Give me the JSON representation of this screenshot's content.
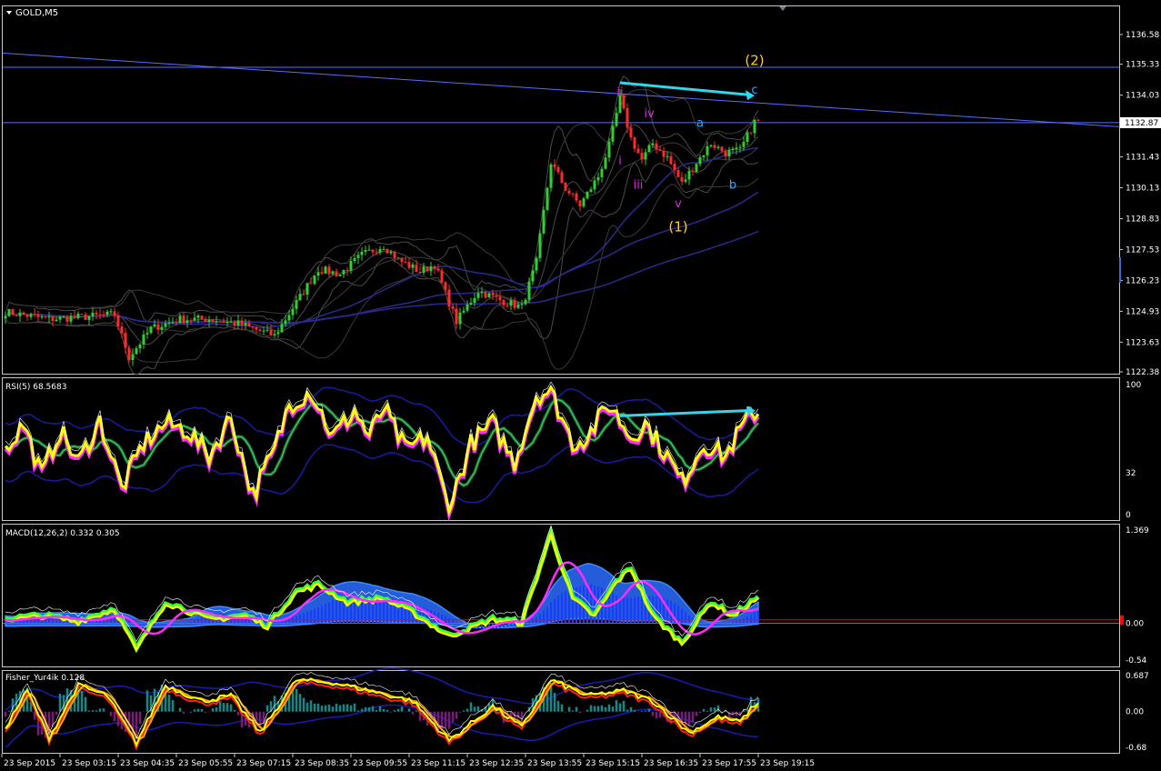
{
  "window": {
    "symbol_label": "GOLD,M5",
    "menu_icon": "triangle-down-icon",
    "corner_icon": "triangle-down-icon"
  },
  "colors": {
    "background": "#000000",
    "frame": "#c8c8c8",
    "text": "#ffffff",
    "bull_candle": "#33cc33",
    "bear_candle": "#ff2a2a",
    "bands": "#4a4a4a",
    "ma_blue": "#2a2a8c",
    "trend_line": "#5a6cff",
    "arrow": "#33d6e8",
    "wave_impulse": "#d62bd6",
    "wave_corrective": "#3aa6ff",
    "wave_degree": "#ffd11a",
    "rsi_main": "#ffff00",
    "rsi_shadow": "#ff2bff",
    "rsi_signal": "#2fcf5a",
    "macd_hist": "#1a3aff",
    "macd_fill": "#2a6cff",
    "macd_main": "#ffff00",
    "macd_signal": "#ff2bff",
    "macd_trend": "#33ff33",
    "zero_line": "#ff0000",
    "fisher_pos": "#128a8a",
    "fisher_neg": "#7a1a7a"
  },
  "chart_data": [
    {
      "type": "candlestick",
      "title": "GOLD,M5",
      "current_price": "1132.87",
      "price_axis_ticks": [
        "1136.58",
        "1135.33",
        "1134.03",
        "1131.43",
        "1130.13",
        "1128.83",
        "1127.53",
        "1126.23",
        "1124.93",
        "1123.63",
        "1122.38"
      ],
      "ylim": [
        1122.38,
        1136.58
      ],
      "grid": false,
      "horizontal_levels": [
        1135.2,
        1132.87
      ],
      "wave_labels": [
        {
          "text": "(2)",
          "group": "degree",
          "bar": 206,
          "price": 1135.3
        },
        {
          "text": "c",
          "group": "corrective",
          "bar": 206,
          "price": 1134.1
        },
        {
          "text": "ii",
          "group": "impulse",
          "bar": 169,
          "price": 1134.0
        },
        {
          "text": "iv",
          "group": "impulse",
          "bar": 177,
          "price": 1133.1
        },
        {
          "text": "a",
          "group": "corrective",
          "bar": 191,
          "price": 1132.7
        },
        {
          "text": "i",
          "group": "impulse",
          "bar": 169,
          "price": 1131.1
        },
        {
          "text": "iii",
          "group": "impulse",
          "bar": 174,
          "price": 1130.1
        },
        {
          "text": "b",
          "group": "corrective",
          "bar": 200,
          "price": 1130.1
        },
        {
          "text": "v",
          "group": "impulse",
          "bar": 185,
          "price": 1129.3
        },
        {
          "text": "(1)",
          "group": "degree",
          "bar": 185,
          "price": 1128.3
        }
      ],
      "annotations": [
        {
          "type": "arrow",
          "from_bar": 169,
          "from_price": 1134.55,
          "to_bar": 204,
          "to_price": 1134.05
        }
      ],
      "key_prices": [
        {
          "bar": 0,
          "price": 1124.9
        },
        {
          "bar": 12,
          "price": 1124.6
        },
        {
          "bar": 22,
          "price": 1124.7
        },
        {
          "bar": 30,
          "price": 1124.8
        },
        {
          "bar": 34,
          "price": 1123.0
        },
        {
          "bar": 40,
          "price": 1124.2
        },
        {
          "bar": 48,
          "price": 1124.6
        },
        {
          "bar": 56,
          "price": 1124.6
        },
        {
          "bar": 64,
          "price": 1124.4
        },
        {
          "bar": 74,
          "price": 1123.9
        },
        {
          "bar": 80,
          "price": 1125.3
        },
        {
          "bar": 86,
          "price": 1126.7
        },
        {
          "bar": 92,
          "price": 1126.5
        },
        {
          "bar": 98,
          "price": 1127.3
        },
        {
          "bar": 104,
          "price": 1127.7
        },
        {
          "bar": 108,
          "price": 1127.1
        },
        {
          "bar": 114,
          "price": 1126.6
        },
        {
          "bar": 118,
          "price": 1126.9
        },
        {
          "bar": 124,
          "price": 1124.5
        },
        {
          "bar": 130,
          "price": 1125.8
        },
        {
          "bar": 136,
          "price": 1125.4
        },
        {
          "bar": 142,
          "price": 1125.1
        },
        {
          "bar": 146,
          "price": 1127.0
        },
        {
          "bar": 150,
          "price": 1131.2
        },
        {
          "bar": 154,
          "price": 1130.1
        },
        {
          "bar": 158,
          "price": 1129.4
        },
        {
          "bar": 163,
          "price": 1130.6
        },
        {
          "bar": 166,
          "price": 1131.9
        },
        {
          "bar": 169,
          "price": 1133.9
        },
        {
          "bar": 172,
          "price": 1132.2
        },
        {
          "bar": 175,
          "price": 1131.3
        },
        {
          "bar": 178,
          "price": 1132.0
        },
        {
          "bar": 182,
          "price": 1131.4
        },
        {
          "bar": 186,
          "price": 1130.3
        },
        {
          "bar": 190,
          "price": 1131.2
        },
        {
          "bar": 194,
          "price": 1132.0
        },
        {
          "bar": 198,
          "price": 1131.6
        },
        {
          "bar": 202,
          "price": 1131.7
        },
        {
          "bar": 206,
          "price": 1132.9
        }
      ]
    },
    {
      "type": "line",
      "title": "RSI(5) 68.5683",
      "axis_ticks": [
        "100",
        "32",
        "0"
      ],
      "ylim": [
        0,
        100
      ],
      "annotations": [
        {
          "type": "arrow",
          "from_bar": 169,
          "to_bar": 204,
          "from_value": 76,
          "to_value": 80
        }
      ],
      "key_values": [
        {
          "bar": 0,
          "value": 50
        },
        {
          "bar": 5,
          "value": 70
        },
        {
          "bar": 10,
          "value": 30
        },
        {
          "bar": 15,
          "value": 65
        },
        {
          "bar": 20,
          "value": 40
        },
        {
          "bar": 26,
          "value": 72
        },
        {
          "bar": 32,
          "value": 20
        },
        {
          "bar": 38,
          "value": 55
        },
        {
          "bar": 44,
          "value": 70
        },
        {
          "bar": 50,
          "value": 65
        },
        {
          "bar": 56,
          "value": 45
        },
        {
          "bar": 62,
          "value": 75
        },
        {
          "bar": 68,
          "value": 15
        },
        {
          "bar": 74,
          "value": 50
        },
        {
          "bar": 78,
          "value": 85
        },
        {
          "bar": 84,
          "value": 95
        },
        {
          "bar": 90,
          "value": 60
        },
        {
          "bar": 96,
          "value": 80
        },
        {
          "bar": 100,
          "value": 60
        },
        {
          "bar": 104,
          "value": 82
        },
        {
          "bar": 110,
          "value": 50
        },
        {
          "bar": 116,
          "value": 60
        },
        {
          "bar": 122,
          "value": 5
        },
        {
          "bar": 128,
          "value": 55
        },
        {
          "bar": 134,
          "value": 70
        },
        {
          "bar": 140,
          "value": 40
        },
        {
          "bar": 146,
          "value": 92
        },
        {
          "bar": 150,
          "value": 95
        },
        {
          "bar": 156,
          "value": 55
        },
        {
          "bar": 160,
          "value": 60
        },
        {
          "bar": 166,
          "value": 85
        },
        {
          "bar": 172,
          "value": 60
        },
        {
          "bar": 176,
          "value": 70
        },
        {
          "bar": 182,
          "value": 45
        },
        {
          "bar": 186,
          "value": 25
        },
        {
          "bar": 192,
          "value": 55
        },
        {
          "bar": 198,
          "value": 45
        },
        {
          "bar": 202,
          "value": 65
        },
        {
          "bar": 206,
          "value": 79
        }
      ]
    },
    {
      "type": "line",
      "title": "MACD(12,26,2) 0.332 0.305",
      "axis_ticks": [
        "1.369",
        "0.00",
        "-0.54"
      ],
      "ylim": [
        -0.54,
        1.369
      ],
      "key_values": [
        {
          "bar": 0,
          "value": 0.05
        },
        {
          "bar": 10,
          "value": 0.1
        },
        {
          "bar": 20,
          "value": 0.02
        },
        {
          "bar": 30,
          "value": 0.2
        },
        {
          "bar": 36,
          "value": -0.4
        },
        {
          "bar": 44,
          "value": 0.3
        },
        {
          "bar": 56,
          "value": 0.05
        },
        {
          "bar": 66,
          "value": 0.1
        },
        {
          "bar": 72,
          "value": -0.05
        },
        {
          "bar": 80,
          "value": 0.45
        },
        {
          "bar": 86,
          "value": 0.55
        },
        {
          "bar": 94,
          "value": 0.3
        },
        {
          "bar": 104,
          "value": 0.35
        },
        {
          "bar": 112,
          "value": 0.15
        },
        {
          "bar": 122,
          "value": -0.2
        },
        {
          "bar": 134,
          "value": 0.05
        },
        {
          "bar": 142,
          "value": 0.0
        },
        {
          "bar": 150,
          "value": 1.3
        },
        {
          "bar": 156,
          "value": 0.35
        },
        {
          "bar": 162,
          "value": 0.1
        },
        {
          "bar": 168,
          "value": 0.6
        },
        {
          "bar": 172,
          "value": 0.8
        },
        {
          "bar": 178,
          "value": 0.1
        },
        {
          "bar": 186,
          "value": -0.3
        },
        {
          "bar": 194,
          "value": 0.3
        },
        {
          "bar": 200,
          "value": 0.1
        },
        {
          "bar": 206,
          "value": 0.33
        }
      ]
    },
    {
      "type": "line",
      "title": "Fisher_Yur4ik 0.128",
      "axis_ticks": [
        "0.687",
        "0.00",
        "-0.68"
      ],
      "ylim": [
        -0.68,
        0.687
      ],
      "key_values": [
        {
          "bar": 0,
          "value": -0.3
        },
        {
          "bar": 6,
          "value": 0.4
        },
        {
          "bar": 12,
          "value": -0.5
        },
        {
          "bar": 20,
          "value": 0.5
        },
        {
          "bar": 28,
          "value": 0.3
        },
        {
          "bar": 36,
          "value": -0.6
        },
        {
          "bar": 44,
          "value": 0.5
        },
        {
          "bar": 54,
          "value": 0.2
        },
        {
          "bar": 62,
          "value": 0.3
        },
        {
          "bar": 70,
          "value": -0.4
        },
        {
          "bar": 80,
          "value": 0.6
        },
        {
          "bar": 90,
          "value": 0.55
        },
        {
          "bar": 100,
          "value": 0.4
        },
        {
          "bar": 112,
          "value": 0.2
        },
        {
          "bar": 122,
          "value": -0.55
        },
        {
          "bar": 134,
          "value": 0.1
        },
        {
          "bar": 142,
          "value": -0.3
        },
        {
          "bar": 150,
          "value": 0.6
        },
        {
          "bar": 160,
          "value": 0.3
        },
        {
          "bar": 170,
          "value": 0.4
        },
        {
          "bar": 178,
          "value": 0.2
        },
        {
          "bar": 188,
          "value": -0.4
        },
        {
          "bar": 196,
          "value": -0.1
        },
        {
          "bar": 202,
          "value": -0.2
        },
        {
          "bar": 206,
          "value": 0.13
        }
      ]
    }
  ],
  "time_axis": {
    "labels": [
      "23 Sep 2015",
      "23 Sep 03:15",
      "23 Sep 04:35",
      "23 Sep 05:55",
      "23 Sep 07:15",
      "23 Sep 08:35",
      "23 Sep 09:55",
      "23 Sep 11:15",
      "23 Sep 12:35",
      "23 Sep 13:55",
      "23 Sep 15:15",
      "23 Sep 16:35",
      "23 Sep 17:55",
      "23 Sep 19:15"
    ],
    "label_bars": [
      0,
      16,
      32,
      48,
      64,
      80,
      96,
      112,
      128,
      144,
      160,
      176,
      192,
      208
    ]
  }
}
